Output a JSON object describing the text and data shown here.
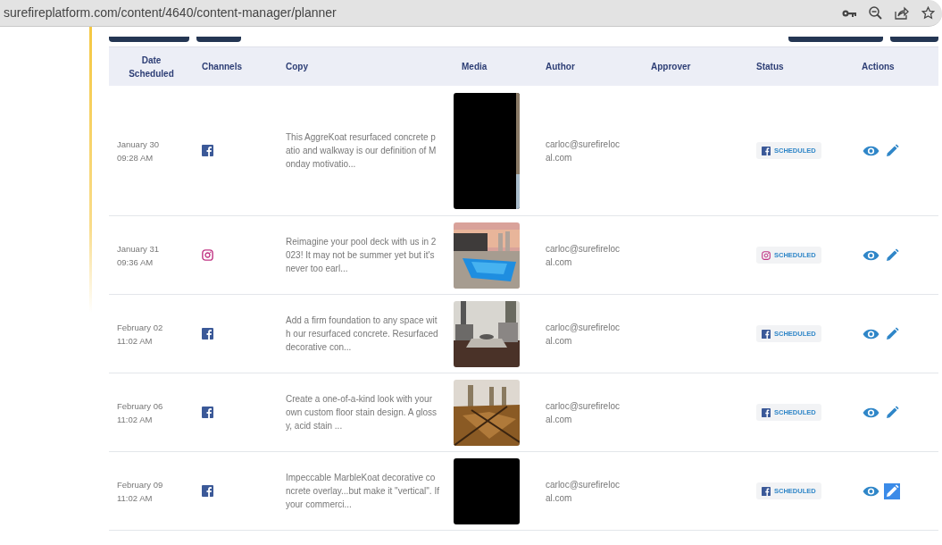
{
  "browser": {
    "url": "surefireplatform.com/content/4640/content-manager/planner"
  },
  "table": {
    "columns": [
      "Date Scheduled",
      "Channels",
      "Copy",
      "Media",
      "Author",
      "Approver",
      "Status",
      "Actions"
    ],
    "rows": [
      {
        "date": "January 30",
        "time": "09:28 AM",
        "channel": {
          "kind": "facebook"
        },
        "copy": "This AggreKoat resurfaced concrete patio and walkway is our definition of Monday motivatio...",
        "media": {
          "kind": "dark_portrait"
        },
        "author": "carloc@surefirelocal.com",
        "status": "SCHEDULED",
        "edit_active": false
      },
      {
        "date": "January 31",
        "time": "09:36 AM",
        "channel": {
          "kind": "instagram"
        },
        "copy": "Reimagine your pool deck with us in 2023! It may not be summer yet but it's never too earl...",
        "media": {
          "kind": "pool"
        },
        "author": "carloc@surefirelocal.com",
        "status": "SCHEDULED",
        "edit_active": false
      },
      {
        "date": "February 02",
        "time": "11:02 AM",
        "channel": {
          "kind": "facebook"
        },
        "copy": "Add a firm foundation to any space with our resurfaced concrete. Resurfaced decorative con...",
        "media": {
          "kind": "room"
        },
        "author": "carloc@surefirelocal.com",
        "status": "SCHEDULED",
        "edit_active": false
      },
      {
        "date": "February 06",
        "time": "11:02 AM",
        "channel": {
          "kind": "facebook"
        },
        "copy": "Create a one-of-a-kind look with your own custom floor stain design. A glossy, acid stain ...",
        "media": {
          "kind": "floor"
        },
        "author": "carloc@surefirelocal.com",
        "status": "SCHEDULED",
        "edit_active": false
      },
      {
        "date": "February 09",
        "time": "11:02 AM",
        "channel": {
          "kind": "facebook"
        },
        "copy": "Impeccable MarbleKoat decorative concrete overlay...but make it \"vertical\". If your commerci...",
        "media": {
          "kind": "dark"
        },
        "author": "carloc@surefirelocal.com",
        "status": "SCHEDULED",
        "edit_active": true
      }
    ]
  }
}
